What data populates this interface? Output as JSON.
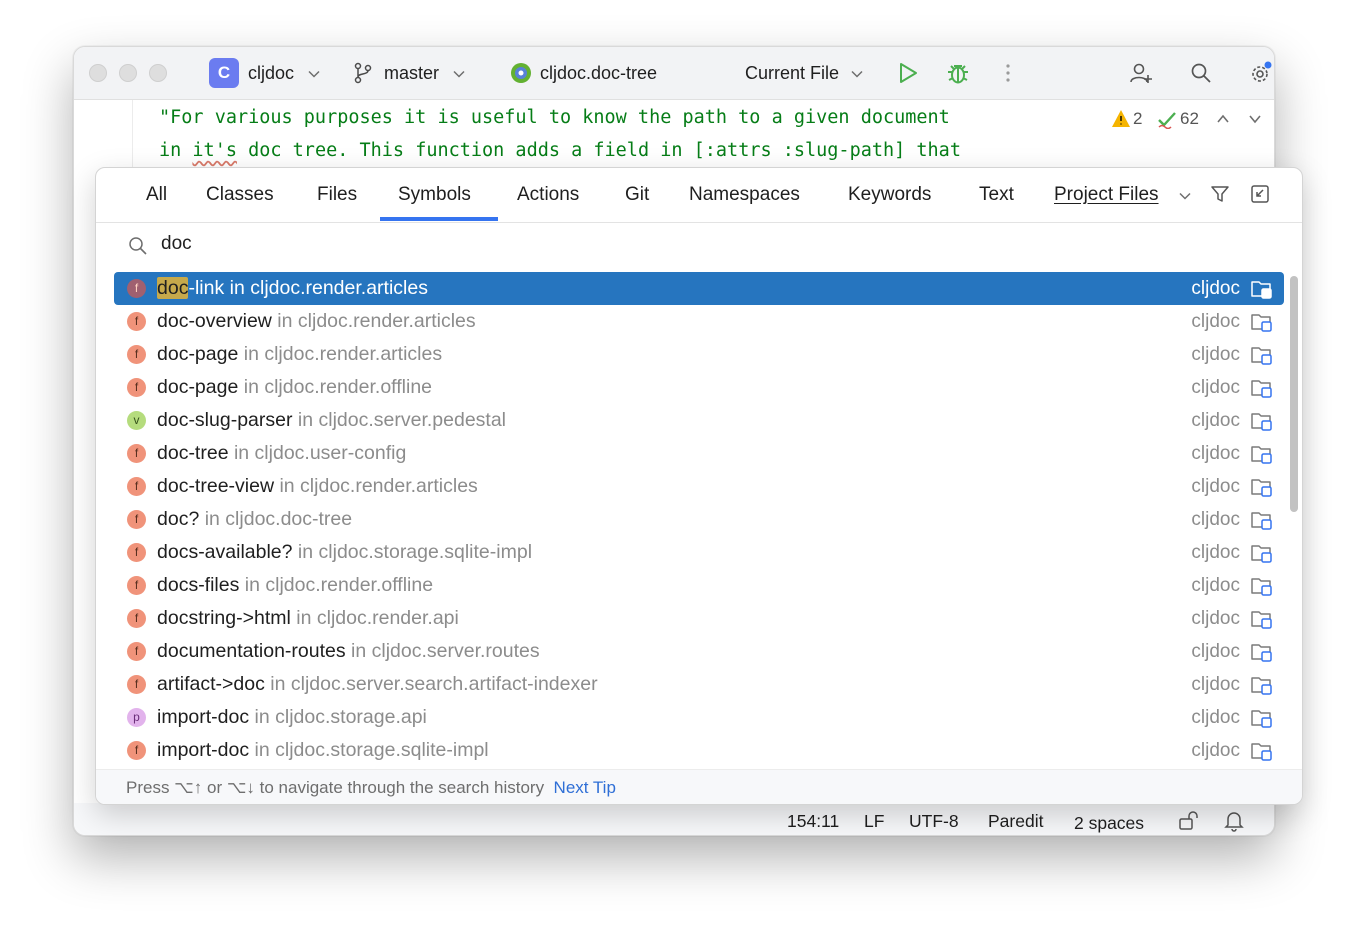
{
  "titlebar": {
    "project_initial": "C",
    "project_name": "cljdoc",
    "branch": "master",
    "file_name": "cljdoc.doc-tree",
    "run_config": "Current File"
  },
  "editor": {
    "code_line1": "\"For various purposes it is useful to know the path to a given document",
    "code_line2_a": "in ",
    "code_line2_squiggle": "it's",
    "code_line2_b": " doc tree. This function adds a field in [:attrs :slug-path] that",
    "warnings_count": "2",
    "checks_count": "62"
  },
  "search_popup": {
    "tabs": [
      {
        "label": "All"
      },
      {
        "label": "Classes"
      },
      {
        "label": "Files"
      },
      {
        "label": "Symbols"
      },
      {
        "label": "Actions"
      },
      {
        "label": "Git"
      },
      {
        "label": "Namespaces"
      },
      {
        "label": "Keywords"
      },
      {
        "label": "Text"
      },
      {
        "label": "Project Files"
      }
    ],
    "active_tab": "Symbols",
    "query": "doc",
    "results": [
      {
        "kind": "f",
        "symbol": "doc-link",
        "ns": " in cljdoc.render.articles",
        "module": "cljdoc"
      },
      {
        "kind": "f",
        "symbol": "doc-overview",
        "ns": " in cljdoc.render.articles",
        "module": "cljdoc"
      },
      {
        "kind": "f",
        "symbol": "doc-page",
        "ns": " in cljdoc.render.articles",
        "module": "cljdoc"
      },
      {
        "kind": "f",
        "symbol": "doc-page",
        "ns": " in cljdoc.render.offline",
        "module": "cljdoc"
      },
      {
        "kind": "v",
        "symbol": "doc-slug-parser",
        "ns": " in cljdoc.server.pedestal",
        "module": "cljdoc"
      },
      {
        "kind": "f",
        "symbol": "doc-tree",
        "ns": " in cljdoc.user-config",
        "module": "cljdoc"
      },
      {
        "kind": "f",
        "symbol": "doc-tree-view",
        "ns": " in cljdoc.render.articles",
        "module": "cljdoc"
      },
      {
        "kind": "f",
        "symbol": "doc?",
        "ns": " in cljdoc.doc-tree",
        "module": "cljdoc"
      },
      {
        "kind": "f",
        "symbol": "docs-available?",
        "ns": " in cljdoc.storage.sqlite-impl",
        "module": "cljdoc"
      },
      {
        "kind": "f",
        "symbol": "docs-files",
        "ns": " in cljdoc.render.offline",
        "module": "cljdoc"
      },
      {
        "kind": "f",
        "symbol": "docstring->html",
        "ns": " in cljdoc.render.api",
        "module": "cljdoc"
      },
      {
        "kind": "f",
        "symbol": "documentation-routes",
        "ns": " in cljdoc.server.routes",
        "module": "cljdoc"
      },
      {
        "kind": "f",
        "symbol": "artifact->doc",
        "ns": " in cljdoc.server.search.artifact-indexer",
        "module": "cljdoc"
      },
      {
        "kind": "p",
        "symbol": "import-doc",
        "ns": " in cljdoc.storage.api",
        "module": "cljdoc"
      },
      {
        "kind": "f",
        "symbol": "import-doc",
        "ns": " in cljdoc.storage.sqlite-impl",
        "module": "cljdoc"
      }
    ],
    "selected_highlight": "doc",
    "selected_rest": "-link",
    "footer_text": "Press ⌥↑ or ⌥↓ to navigate through the search history",
    "footer_link": "Next Tip"
  },
  "statusbar": {
    "position": "154:11",
    "line_ending": "LF",
    "encoding": "UTF-8",
    "mode": "Paredit",
    "indent": "2 spaces"
  },
  "icons": {
    "branch": "git-branch-icon",
    "run": "run-icon",
    "debug": "debug-icon",
    "search": "search-icon",
    "settings": "gear-icon",
    "filter": "filter-icon",
    "module": "module-folder-icon"
  },
  "colors": {
    "accent": "#3574f0",
    "selection": "#2675bf",
    "string_green": "#067d17",
    "run_green": "#4caf50"
  }
}
